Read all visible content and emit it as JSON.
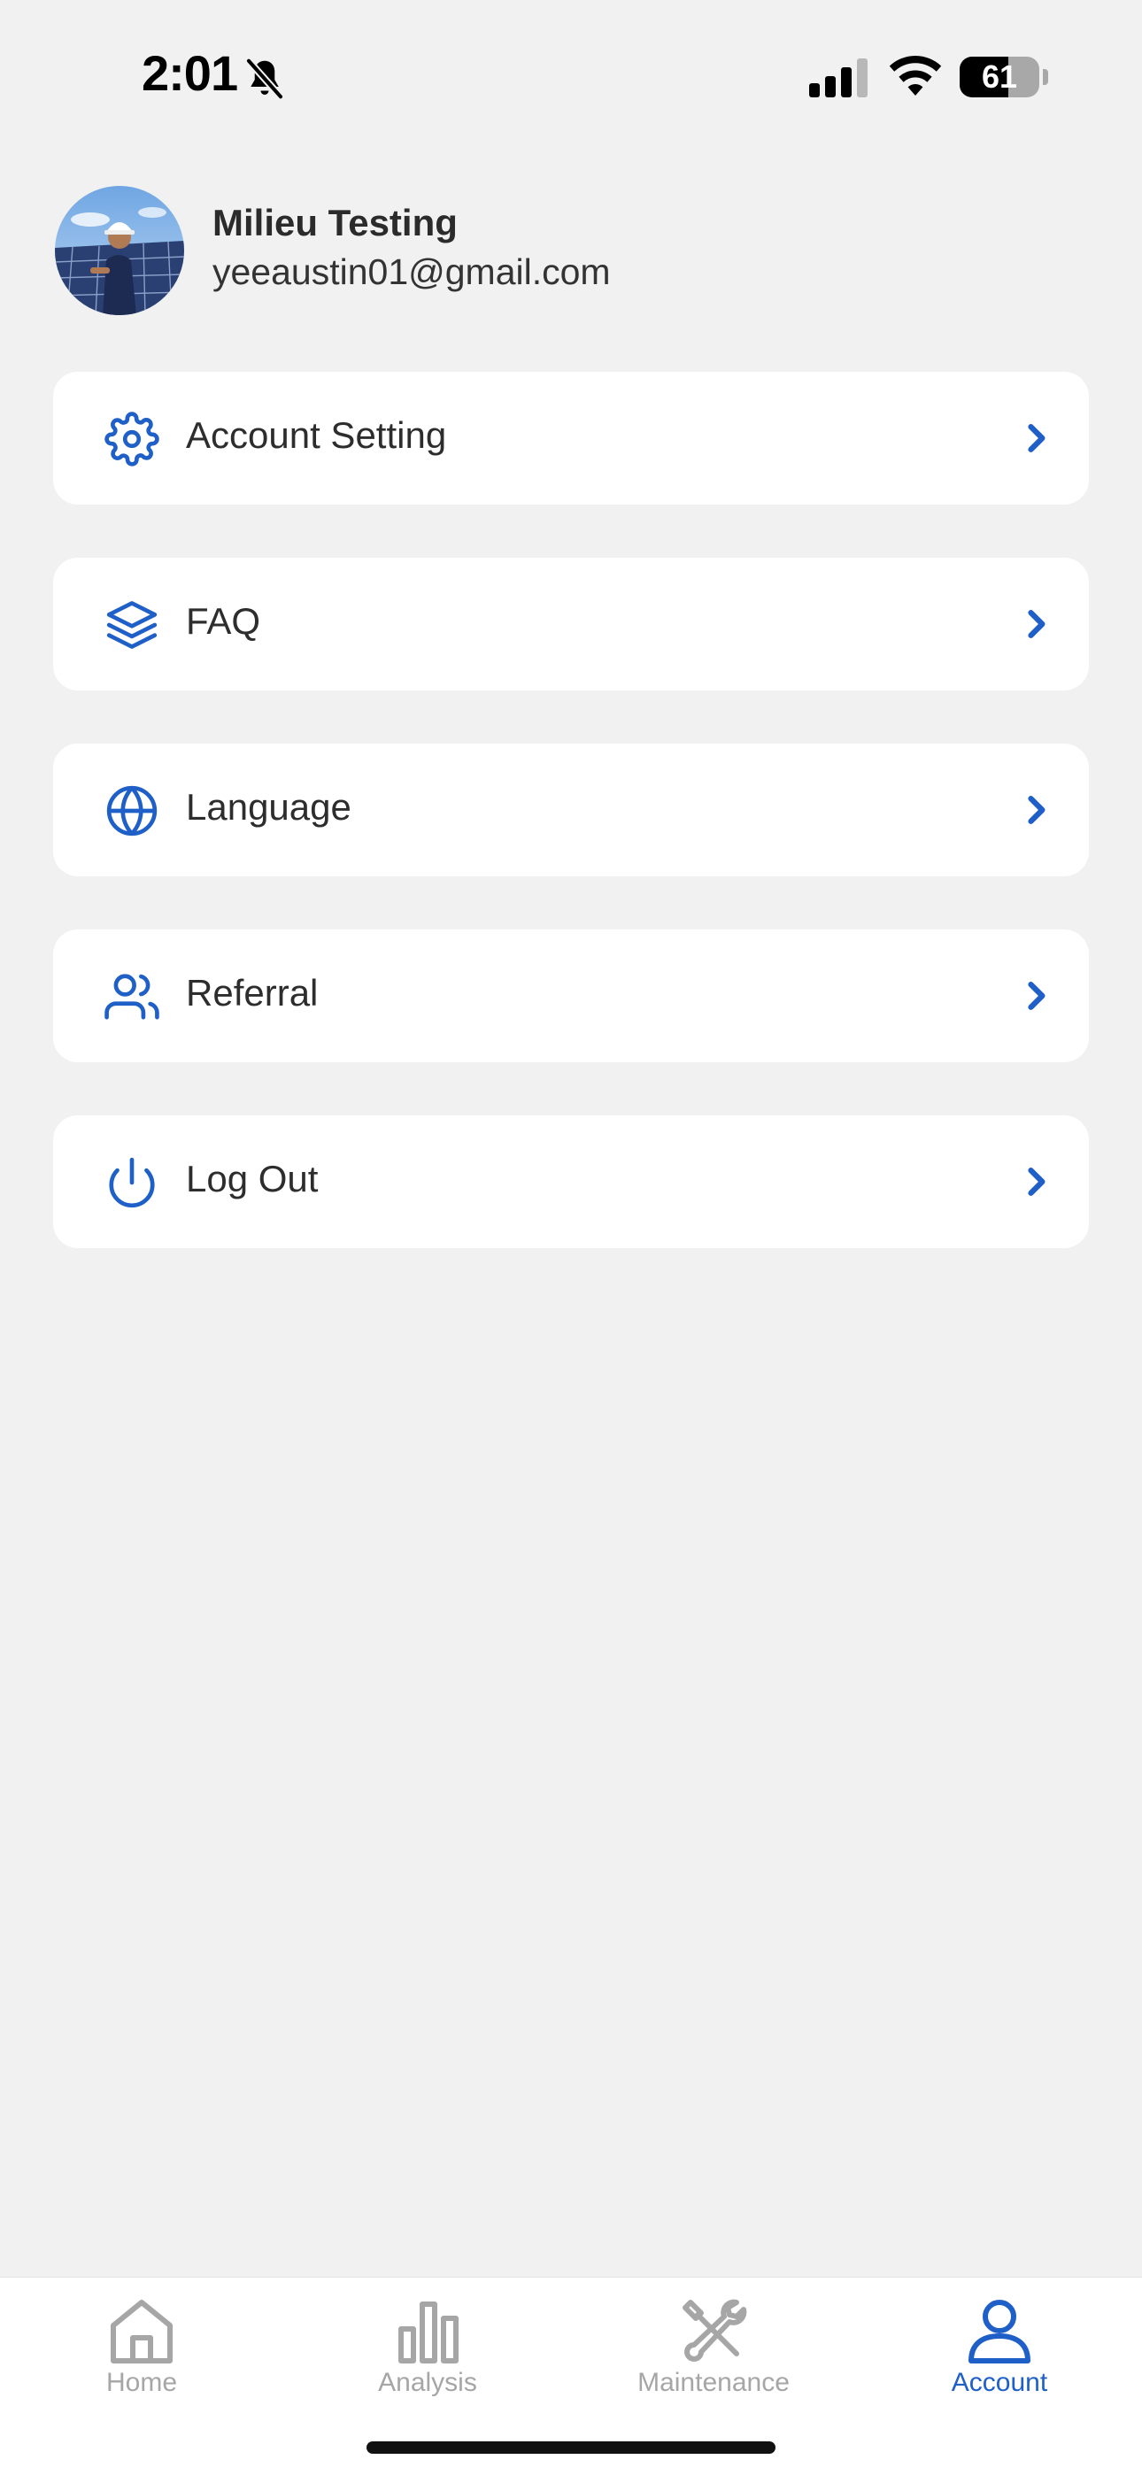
{
  "status_bar": {
    "time": "2:01",
    "battery_level": "61",
    "battery_fraction": 0.61
  },
  "profile": {
    "name": "Milieu Testing",
    "email": "yeeaustin01@gmail.com"
  },
  "menu": {
    "items": [
      {
        "label": "Account Setting",
        "icon": "gear-icon"
      },
      {
        "label": "FAQ",
        "icon": "layers-icon"
      },
      {
        "label": "Language",
        "icon": "globe-icon"
      },
      {
        "label": "Referral",
        "icon": "users-icon"
      },
      {
        "label": "Log Out",
        "icon": "power-icon"
      }
    ]
  },
  "tab_bar": {
    "tabs": [
      {
        "label": "Home",
        "icon": "home-icon",
        "active": false
      },
      {
        "label": "Analysis",
        "icon": "bar-chart-icon",
        "active": false
      },
      {
        "label": "Maintenance",
        "icon": "tools-icon",
        "active": false
      },
      {
        "label": "Account",
        "icon": "user-icon",
        "active": true
      }
    ]
  },
  "colors": {
    "accent": "#1f5fc8",
    "background": "#f1f1f1",
    "card": "#ffffff",
    "inactive_tab": "#a6a6a6"
  }
}
